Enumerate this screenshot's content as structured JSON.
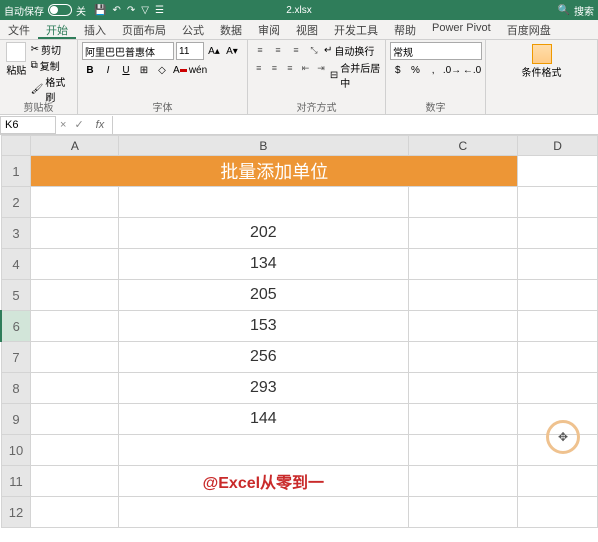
{
  "titlebar": {
    "autosave_label": "自动保存",
    "autosave_state": "关",
    "filename": "2.xlsx",
    "search_placeholder": "搜索"
  },
  "tabs": [
    "文件",
    "开始",
    "插入",
    "页面布局",
    "公式",
    "数据",
    "审阅",
    "视图",
    "开发工具",
    "帮助",
    "Power Pivot",
    "百度网盘"
  ],
  "active_tab": 1,
  "ribbon": {
    "clipboard": {
      "label": "剪贴板",
      "paste": "粘贴",
      "cut": "剪切",
      "copy": "复制",
      "painter": "格式刷"
    },
    "font": {
      "label": "字体",
      "family": "阿里巴巴普惠体",
      "size": "11"
    },
    "align": {
      "label": "对齐方式",
      "wrap": "自动换行",
      "merge": "合并后居中"
    },
    "number": {
      "label": "数字",
      "format": "常规"
    },
    "styles": {
      "cond_fmt": "条件格式"
    }
  },
  "namebox": {
    "ref": "K6",
    "formula": ""
  },
  "columns": [
    "A",
    "B",
    "C",
    "D"
  ],
  "rows": {
    "title_text": "批量添加单位",
    "data": [
      "202",
      "134",
      "205",
      "153",
      "256",
      "293",
      "144"
    ],
    "watermark": "@Excel从零到一",
    "selected": 6,
    "count": 12
  }
}
